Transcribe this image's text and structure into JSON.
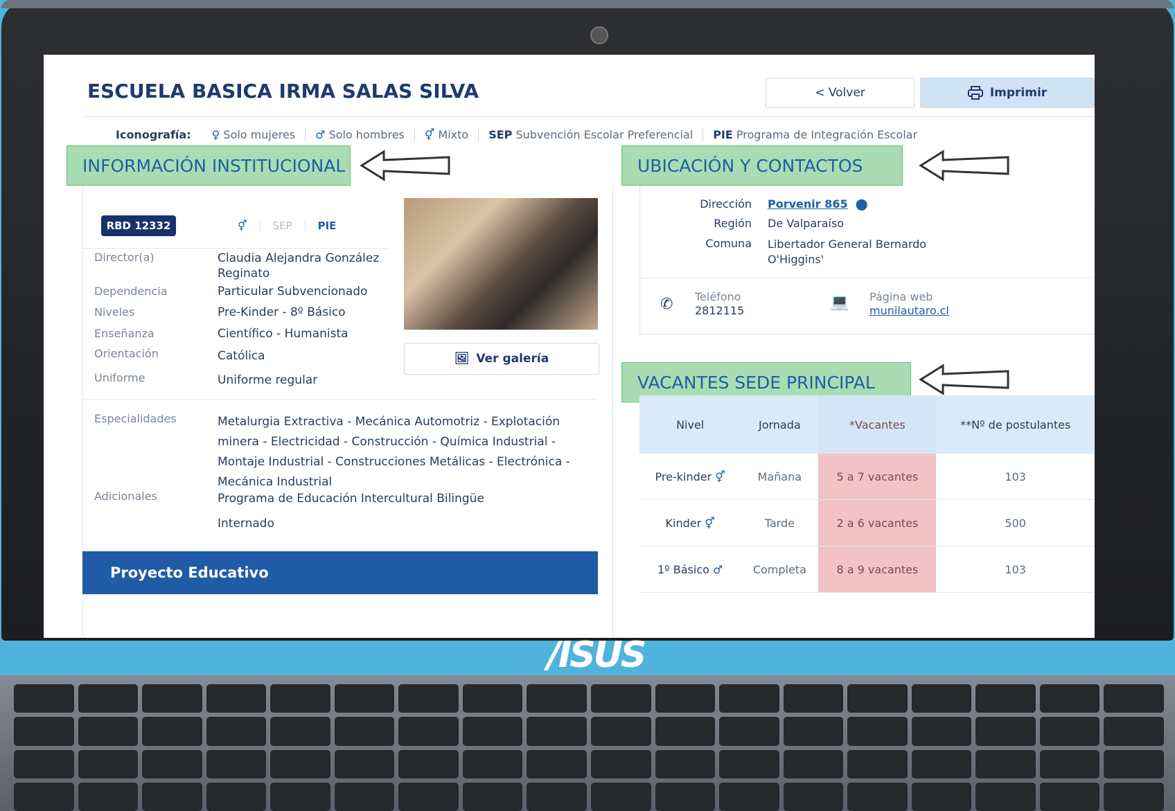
{
  "brand": "/ISUS",
  "page": {
    "title": "ESCUELA BASICA IRMA SALAS SILVA",
    "back_label": "< Volver",
    "print_label": "Imprimir"
  },
  "iconography": {
    "label": "Iconografía:",
    "items": [
      "Solo mujeres",
      "Solo hombres",
      "Mixto"
    ],
    "sep_code": "SEP",
    "sep_text": "Subvención Escolar Preferencial",
    "pie_code": "PIE",
    "pie_text": "Programa de Integración Escolar"
  },
  "sections": {
    "info": "INFORMACIÓN INSTITUCIONAL",
    "location": "UBICACIÓN Y CONTACTOS",
    "vacancies": "VACANTES SEDE PRINCIPAL"
  },
  "institution": {
    "rbd": "RBD 12332",
    "badge_sep": "SEP",
    "badge_pie": "PIE",
    "gallery_label": "Ver galería",
    "fields": [
      {
        "label": "Director(a)",
        "value": "Claudia Alejandra González Reginato"
      },
      {
        "label": "Dependencia",
        "value": "Particular Subvencionado"
      },
      {
        "label": "Niveles",
        "value": "Pre-Kinder - 8º Básico"
      },
      {
        "label": "Enseñanza",
        "value": "Científico - Humanista"
      },
      {
        "label": "Orientación",
        "value": "Católica"
      },
      {
        "label": "Uniforme",
        "value": "Uniforme regular"
      }
    ],
    "specialties_label": "Especialidades",
    "specialties": "Metalurgia Extractiva - Mecánica Automotriz - Explotación minera - Electricidad - Construcción - Química Industrial - Montaje Industrial - Construcciones Metálicas - Electrónica - Mecánica Industrial",
    "additional_label": "Adicionales",
    "additional": [
      "Programa de Educación Intercultural Bilingüe",
      "Internado"
    ],
    "project_title": "Proyecto Educativo"
  },
  "location": {
    "address_label": "Dirección",
    "address": "Porvenir 865",
    "region_label": "Región",
    "region": "De Valparaíso",
    "commune_label": "Comuna",
    "commune": "Libertador General Bernardo O'Higgins'",
    "phone_label": "Teléfono",
    "phone": "2812115",
    "web_label": "Página web",
    "web": "munilautaro.cl"
  },
  "vacancies": {
    "headers": [
      "Nivel",
      "Jornada",
      "*Vacantes",
      "**Nº de postulantes"
    ],
    "rows": [
      {
        "level": "Pre-kinder",
        "shift": "Mañana",
        "vacancies": "5 a 7 vacantes",
        "applicants": "103"
      },
      {
        "level": "Kinder",
        "shift": "Tarde",
        "vacancies": "2 a 6 vacantes",
        "applicants": "500"
      },
      {
        "level": "1º Básico",
        "shift": "Completa",
        "vacancies": "8 a 9 vacantes",
        "applicants": "103"
      }
    ]
  },
  "colors": {
    "accent": "#1f5fa6",
    "title": "#1f3a6e",
    "section_bg": "#a9dcb2",
    "highlight": "#f2c2c5"
  }
}
